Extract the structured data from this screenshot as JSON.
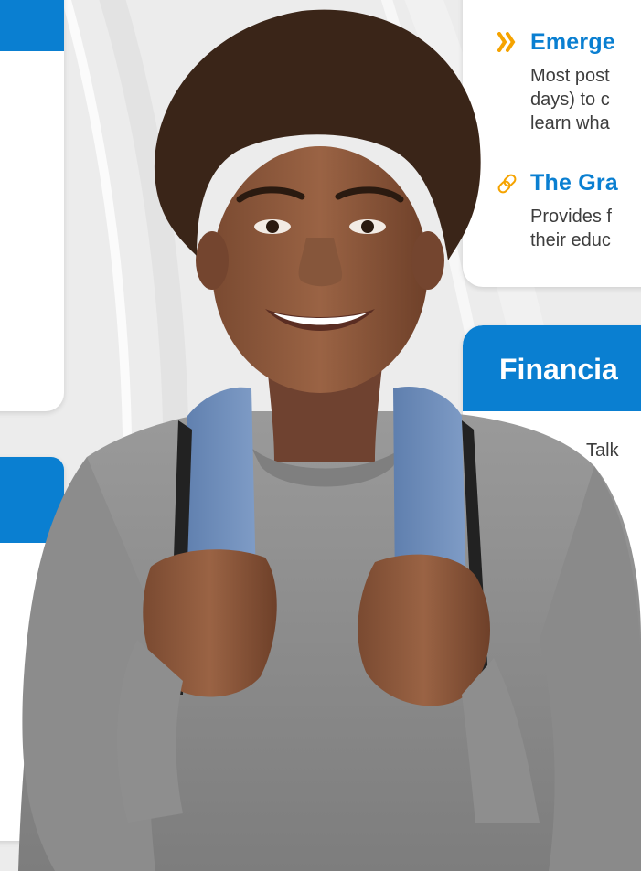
{
  "panel_top_right": {
    "items": [
      {
        "icon": "double-chevron-right-icon",
        "title": "Emerge",
        "lines": [
          "Most post",
          "days) to c",
          "learn wha"
        ]
      },
      {
        "icon": "link-icon",
        "title": "The Gra",
        "lines": [
          "Provides f",
          "their educ"
        ]
      }
    ]
  },
  "panel_financial": {
    "title": "Financia",
    "body_text": "Talk"
  },
  "colors": {
    "brand_blue": "#0a7fd1",
    "accent_orange": "#f5a300",
    "text_gray": "#3d3d3d",
    "background": "#ececec"
  }
}
